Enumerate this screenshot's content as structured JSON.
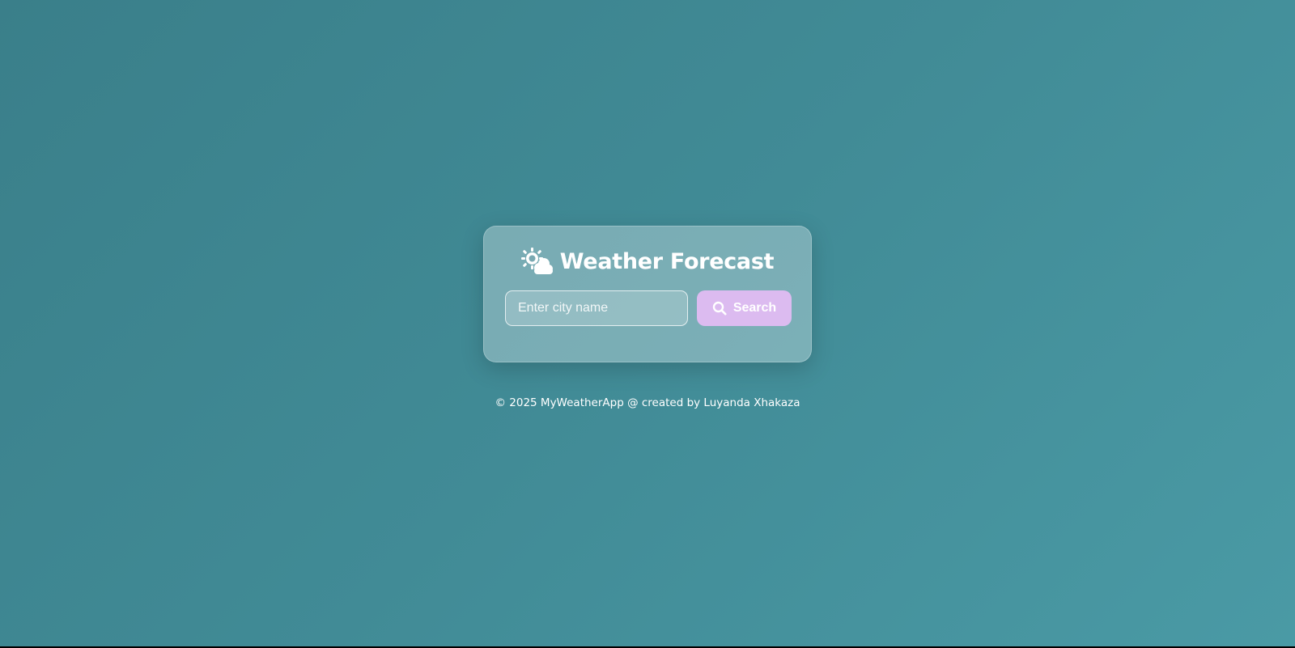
{
  "app": {
    "title": "Weather Forecast",
    "title_icon": "sun-behind-cloud-icon"
  },
  "search": {
    "placeholder": "Enter city name",
    "value": "",
    "button_label": "Search",
    "button_icon": "search-icon",
    "button_color": "#dcbbf0"
  },
  "footer": {
    "text": "© 2025 MyWeatherApp @ created by Luyanda Xhakaza"
  },
  "colors": {
    "background_start": "#3a7f8a",
    "background_end": "#4a9aa5"
  }
}
